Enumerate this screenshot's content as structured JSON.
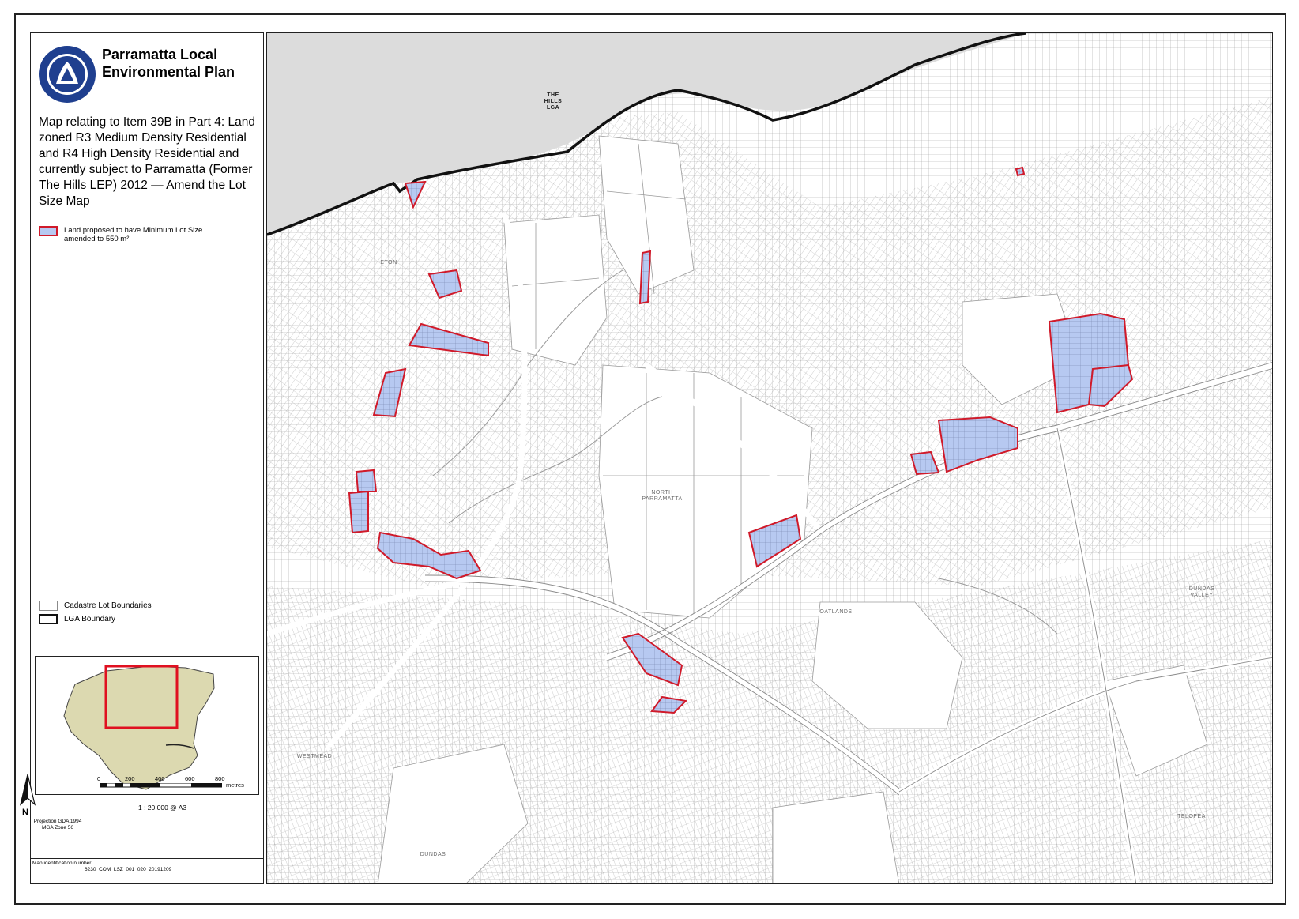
{
  "title": "Parramatta Local Environmental Plan",
  "subtitle": "Map relating to Item 39B in Part 4: Land zoned R3 Medium Density Residential and R4 High Density Residential and currently subject to Parramatta (Former The Hills LEP) 2012 — Amend the Lot Size Map",
  "logo_text": "CITY OF PARRAMATTA",
  "legend": {
    "proposed_label": "Land proposed to have Minimum Lot Size amended to 550 m²",
    "cadastre_label": "Cadastre Lot Boundaries",
    "lga_label": "LGA Boundary"
  },
  "north_label": "N",
  "projection": "Projection GDA 1994 MGA Zone 56",
  "scale": {
    "ticks": [
      "0",
      "200",
      "400",
      "600",
      "800"
    ],
    "unit": "metres",
    "caption": "1 : 20,000 @ A3"
  },
  "map_id_label": "Map identification number",
  "map_id": "6230_COM_LSZ_001_020_20191209",
  "place_labels": {
    "hills": "THE HILLS LGA",
    "north_parramatta": "NORTH PARRAMATTA",
    "oatlands": "OATLANDS",
    "dundas_valley": "DUNDAS VALLEY",
    "westmead": "WESTMEAD",
    "telopea": "TELOPEA",
    "carlingford": "ETON",
    "dundas": "DUNDAS"
  },
  "colors": {
    "proposed_fill": "#b7c9f1",
    "proposed_stroke": "#d01a2a",
    "outside_lga": "#dcdcdc",
    "cadastre": "#9a9a9a",
    "inset_fill": "#dcd9b0",
    "inset_frame": "#e01020"
  }
}
